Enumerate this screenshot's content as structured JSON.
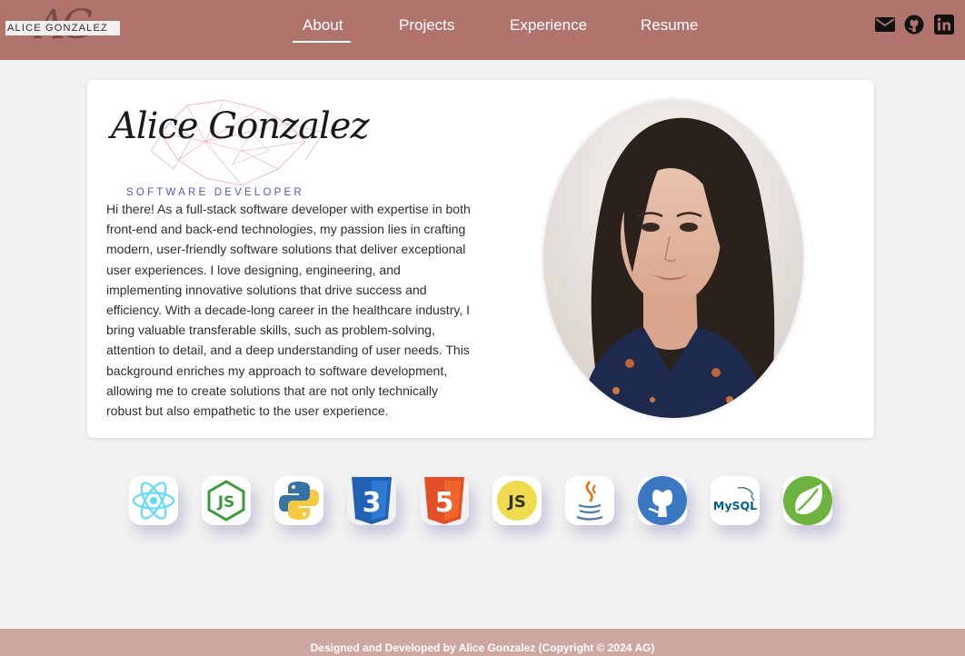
{
  "header": {
    "brand": {
      "monogram": "AG",
      "name": "ALICE GONZALEZ"
    },
    "nav": [
      {
        "label": "About",
        "active": true
      },
      {
        "label": "Projects",
        "active": false
      },
      {
        "label": "Experience",
        "active": false
      },
      {
        "label": "Resume",
        "active": false
      }
    ],
    "social": [
      "mail-icon",
      "github-icon",
      "linkedin-icon"
    ]
  },
  "about": {
    "signature_name": "Alice Gonzalez",
    "signature_title": "SOFTWARE DEVELOPER",
    "bio": "Hi there! As a full-stack software developer with expertise in both front-end and back-end technologies, my passion lies in crafting modern, user-friendly software solutions that deliver exceptional user experiences. I love designing, engineering, and implementing innovative solutions that drive success and efficiency. With a decade-long career in the healthcare industry, I bring valuable transferable skills, such as problem-solving, attention to detail, and a deep understanding of user needs. This background enriches my approach to software development, allowing me to create solutions that are not only technically robust but also empathetic to the user experience.",
    "photo": "profile-photo"
  },
  "skills": [
    {
      "icon": "react-icon",
      "text": ""
    },
    {
      "icon": "nodejs-icon",
      "text": "JS"
    },
    {
      "icon": "python-icon",
      "text": ""
    },
    {
      "icon": "css3-icon",
      "text": "3"
    },
    {
      "icon": "html5-icon",
      "text": "5"
    },
    {
      "icon": "javascript-icon",
      "text": "JS"
    },
    {
      "icon": "java-icon",
      "text": ""
    },
    {
      "icon": "github-icon",
      "text": ""
    },
    {
      "icon": "mysql-icon",
      "text": "MySQL"
    },
    {
      "icon": "spring-icon",
      "text": ""
    }
  ],
  "footer": {
    "text": "Designed and Developed by Alice Gonzalez (Copyright © 2024 AG)"
  },
  "colors": {
    "header": "#b0746c",
    "footer": "#cea7a1",
    "background": "#f2f2f2",
    "accent_blue": "#4b5bb5"
  }
}
